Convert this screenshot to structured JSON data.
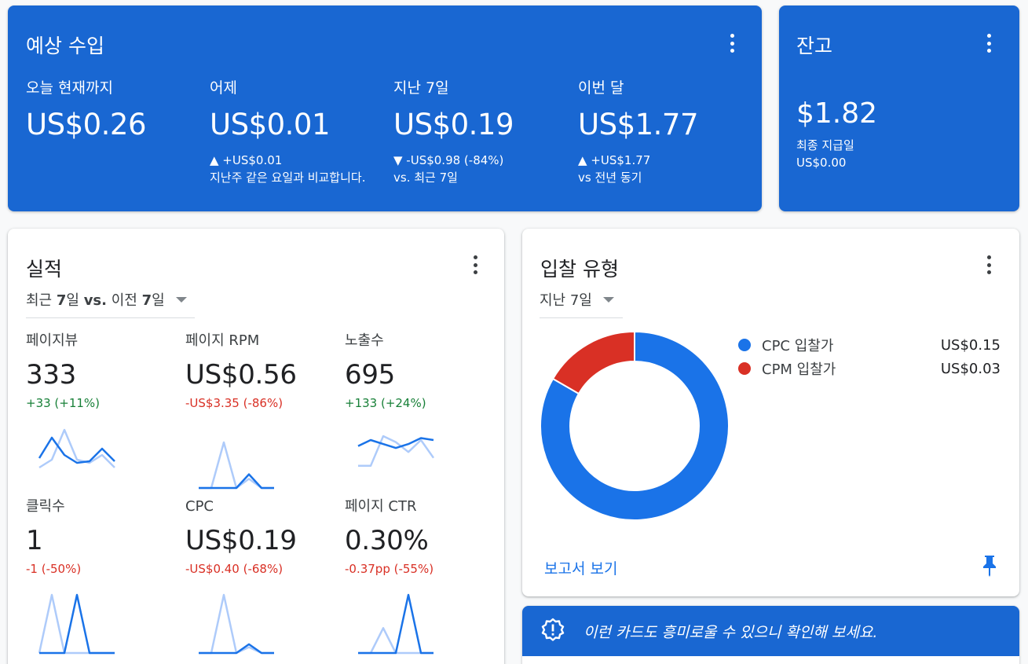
{
  "colors": {
    "card_blue": "#1967d2",
    "positive": "#188038",
    "negative": "#d93025",
    "series_current": "#1a73e8",
    "series_previous": "#aecbfa",
    "cpc": "#1a73e8",
    "cpm": "#d93025"
  },
  "earnings": {
    "title": "예상 수입",
    "columns": [
      {
        "label": "오늘 현재까지",
        "value": "US$0.26",
        "delta1": "",
        "delta2": ""
      },
      {
        "label": "어제",
        "value": "US$0.01",
        "delta1": "▲ +US$0.01",
        "delta2": "지난주 같은 요일과 비교합니다."
      },
      {
        "label": "지난 7일",
        "value": "US$0.19",
        "delta1": "▼ -US$0.98 (-84%)",
        "delta2": "vs. 최근 7일"
      },
      {
        "label": "이번 달",
        "value": "US$1.77",
        "delta1": "▲ +US$1.77",
        "delta2": "vs 전년 동기"
      }
    ]
  },
  "balance": {
    "title": "잔고",
    "value": "$1.82",
    "last_payment_label": "최종 지급일",
    "last_payment_value": "US$0.00"
  },
  "performance": {
    "title": "실적",
    "range_prefix": "최근",
    "range_a": "7",
    "range_mid": "일",
    "range_vs": "vs.",
    "range_suffix": "이전",
    "range_b": "7",
    "range_end": "일",
    "metrics": [
      {
        "label": "페이지뷰",
        "value": "333",
        "delta": "+33 (+11%)",
        "trend": "positive",
        "current": [
          22,
          48,
          26,
          16,
          18,
          34,
          18
        ],
        "previous": [
          10,
          20,
          58,
          20,
          16,
          26,
          10
        ]
      },
      {
        "label": "페이지 RPM",
        "value": "US$0.56",
        "delta": "-US$3.35 (-86%)",
        "trend": "negative",
        "current": [
          0,
          0,
          0,
          0,
          12,
          0,
          0
        ],
        "previous": [
          0,
          0,
          40,
          0,
          8,
          0,
          0
        ]
      },
      {
        "label": "노출수",
        "value": "695",
        "delta": "+133 (+24%)",
        "trend": "positive",
        "current": [
          36,
          42,
          38,
          34,
          38,
          44,
          42
        ],
        "previous": [
          16,
          16,
          46,
          40,
          30,
          42,
          24
        ]
      },
      {
        "label": "클릭수",
        "value": "1",
        "delta": "-1 (-50%)",
        "trend": "negative",
        "current": [
          0,
          0,
          0,
          1,
          0,
          0,
          0
        ],
        "previous": [
          0,
          1,
          0,
          0,
          0,
          0,
          0
        ]
      },
      {
        "label": "CPC",
        "value": "US$0.19",
        "delta": "-US$0.40 (-68%)",
        "trend": "negative",
        "current": [
          0,
          0,
          0,
          0,
          6,
          0,
          0
        ],
        "previous": [
          0,
          0,
          40,
          0,
          4,
          0,
          0
        ]
      },
      {
        "label": "페이지 CTR",
        "value": "0.30%",
        "delta": "-0.37pp (-55%)",
        "trend": "negative",
        "current": [
          0,
          0,
          0,
          0,
          70,
          0,
          0
        ],
        "previous": [
          0,
          0,
          30,
          0,
          0,
          0,
          0
        ]
      }
    ]
  },
  "bid_type": {
    "title": "입찰 유형",
    "range": "지난 7일",
    "link": "보고서 보기",
    "chart_data": {
      "type": "pie",
      "categories": [
        "CPC 입찰가",
        "CPM 입찰가"
      ],
      "values": [
        0.15,
        0.03
      ],
      "value_labels": [
        "US$0.15",
        "US$0.03"
      ]
    }
  },
  "tip": {
    "text": "이런 카드도 흥미로울 수 있으니 확인해 보세요."
  }
}
